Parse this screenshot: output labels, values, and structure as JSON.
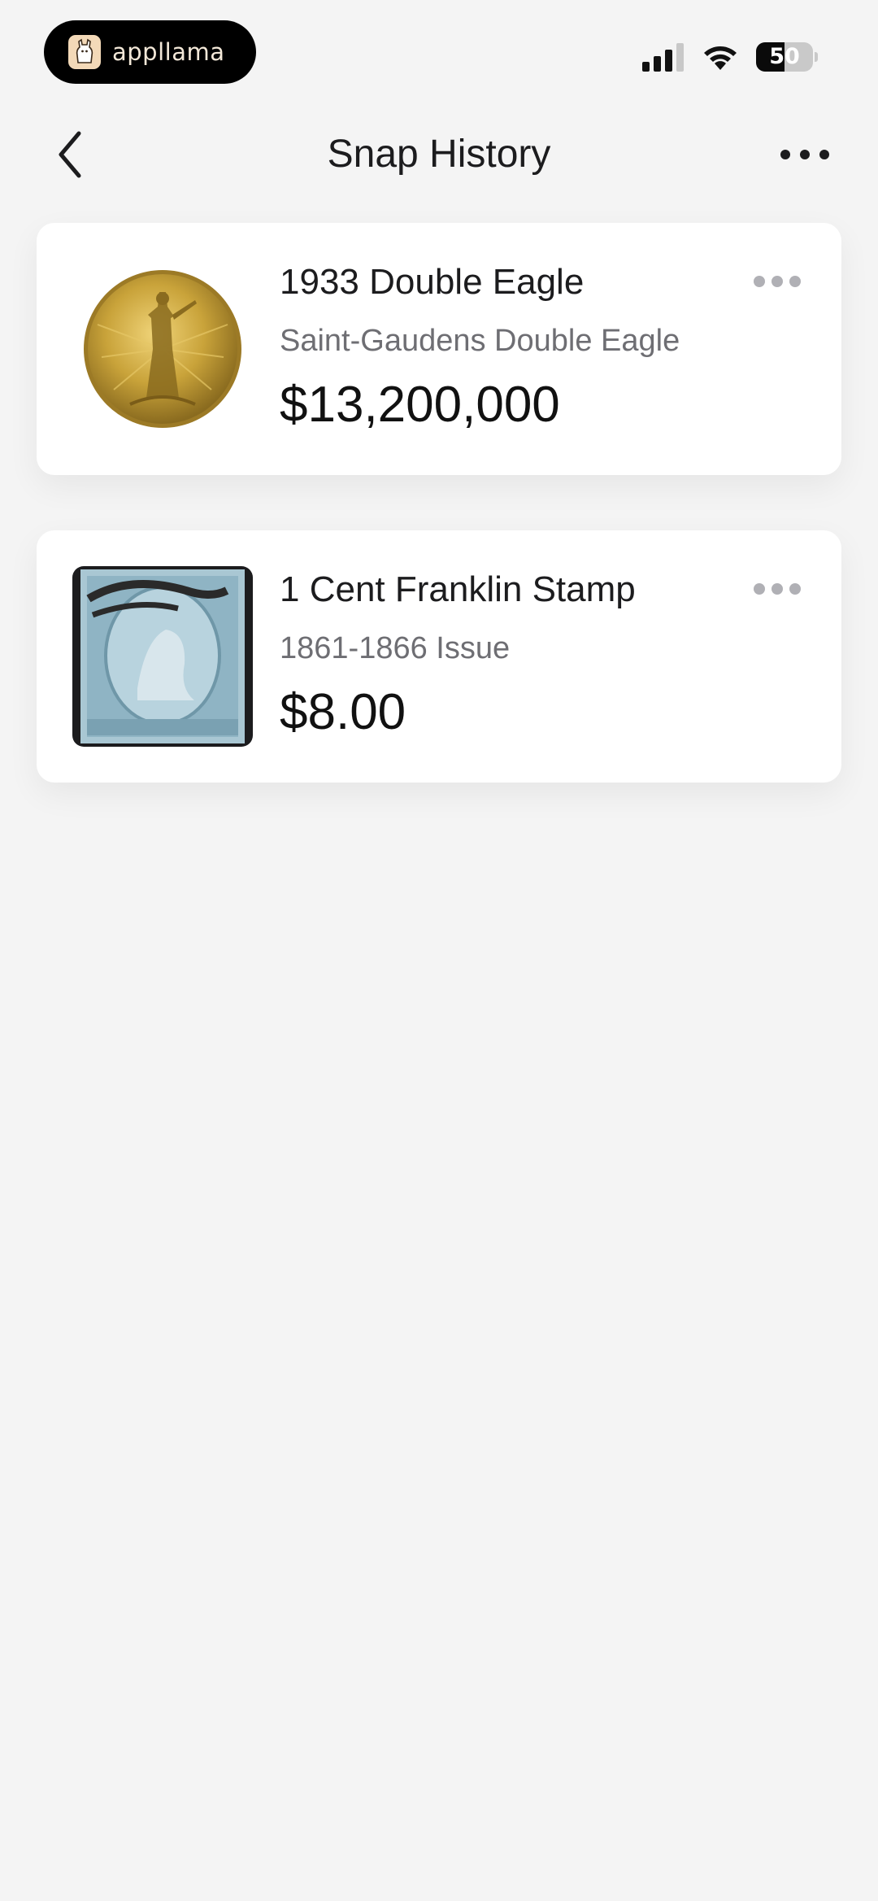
{
  "status_bar": {
    "app_name": "appllama",
    "battery_level": "50",
    "battery_percent": 50,
    "icons": [
      "llama-logo-icon",
      "cellular-signal-icon",
      "wifi-icon",
      "battery-icon"
    ]
  },
  "nav": {
    "title": "Snap History",
    "back_icon": "chevron-left-icon",
    "more_icon": "more-horizontal-icon"
  },
  "items": [
    {
      "name": "1933 Double Eagle",
      "subtitle": "Saint-Gaudens Double Eagle",
      "price": "$13,200,000",
      "thumbnail": "gold-coin-image",
      "menu_icon": "more-horizontal-icon"
    },
    {
      "name": "1 Cent Franklin Stamp",
      "subtitle": "1861-1866 Issue",
      "price": "$8.00",
      "thumbnail": "blue-stamp-image",
      "menu_icon": "more-horizontal-icon"
    }
  ],
  "colors": {
    "background": "#f4f4f4",
    "card": "#ffffff",
    "text_primary": "#1c1c1e",
    "text_secondary": "#6e6e73",
    "gold": "#c9a33a",
    "stamp_blue": "#8fb4c4"
  }
}
